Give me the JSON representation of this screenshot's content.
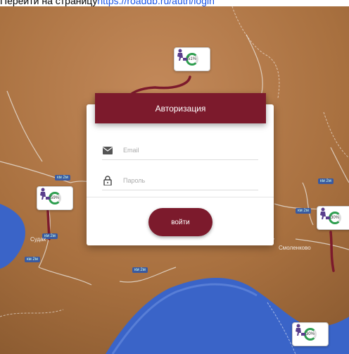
{
  "header_line": {
    "prefix": "Перейти на страницу",
    "link": "https://roaddb.ru/auth/login"
  },
  "map": {
    "cities": [
      "Судак",
      "Смоленково"
    ],
    "road_labels": [
      "км 2м",
      "км 2м",
      "км 2м",
      "км 2м",
      "км 2м",
      "км 2м"
    ],
    "markers": [
      {
        "percent": "51%"
      },
      {
        "percent": "59%"
      },
      {
        "percent": "30%"
      },
      {
        "percent": "30%"
      }
    ]
  },
  "auth": {
    "title": "Авторизация",
    "email_placeholder": "Email",
    "password_placeholder": "Пароль",
    "submit_label": "войти"
  },
  "colors": {
    "brand": "#7c1a2c",
    "progress": "#2e9e4f",
    "water": "#3a64c8"
  }
}
